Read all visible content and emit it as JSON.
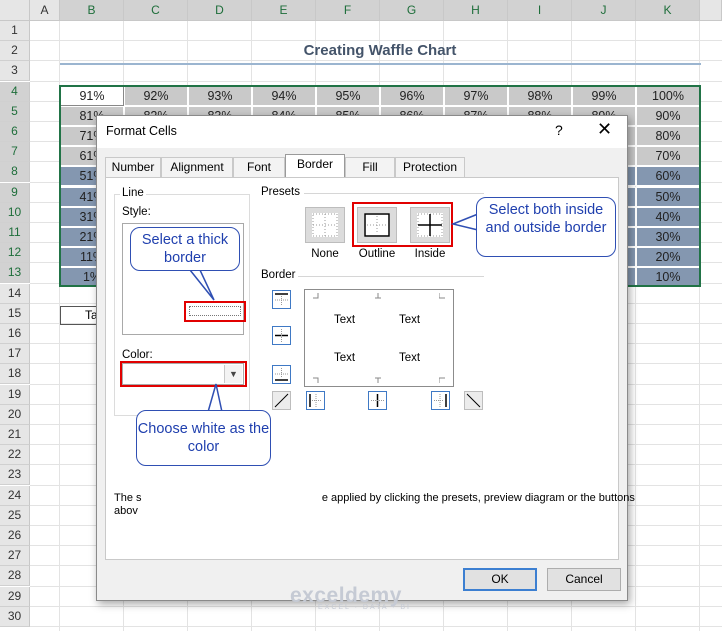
{
  "sheet": {
    "columns": [
      "A",
      "B",
      "C",
      "D",
      "E",
      "F",
      "G",
      "H",
      "I",
      "J",
      "K"
    ],
    "rows": [
      "1",
      "2",
      "3",
      "4",
      "5",
      "6",
      "7",
      "8",
      "9",
      "10",
      "11",
      "12",
      "13",
      "14",
      "15",
      "16",
      "17",
      "18",
      "19",
      "20",
      "21",
      "22",
      "23",
      "24",
      "25",
      "26",
      "27",
      "28",
      "29",
      "30"
    ],
    "title": "Creating Waffle Chart",
    "grid": [
      [
        "91%",
        "92%",
        "93%",
        "94%",
        "95%",
        "96%",
        "97%",
        "98%",
        "99%",
        "100%"
      ],
      [
        "81%",
        "82%",
        "83%",
        "84%",
        "85%",
        "86%",
        "87%",
        "88%",
        "89%",
        "90%"
      ],
      [
        "71%",
        "",
        "",
        "",
        "",
        "",
        "",
        "",
        "",
        "80%"
      ],
      [
        "61%",
        "",
        "",
        "",
        "",
        "",
        "",
        "",
        "",
        "70%"
      ],
      [
        "51%",
        "",
        "",
        "",
        "",
        "",
        "",
        "",
        "",
        "60%"
      ],
      [
        "41%",
        "",
        "",
        "",
        "",
        "",
        "",
        "",
        "",
        "50%"
      ],
      [
        "31%",
        "",
        "",
        "",
        "",
        "",
        "",
        "",
        "",
        "40%"
      ],
      [
        "21%",
        "",
        "",
        "",
        "",
        "",
        "",
        "",
        "",
        "30%"
      ],
      [
        "11%",
        "",
        "",
        "",
        "",
        "",
        "",
        "",
        "",
        "20%"
      ],
      [
        "1%",
        "",
        "",
        "",
        "",
        "",
        "",
        "",
        "",
        "10%"
      ]
    ],
    "legend_cell": "Ta",
    "colors": {
      "filled": "#8497b0",
      "empty": "#c9c9c9",
      "selection": "#217346"
    }
  },
  "dialog": {
    "title": "Format Cells",
    "help": "?",
    "close": "✕",
    "tabs": [
      "Number",
      "Alignment",
      "Font",
      "Border",
      "Fill",
      "Protection"
    ],
    "active_tab": "Border",
    "line_group": "Line",
    "style_label": "Style:",
    "color_label": "Color:",
    "presets_label": "Presets",
    "presets": [
      "None",
      "Outline",
      "Inside"
    ],
    "border_label": "Border",
    "preview_text": [
      "Text",
      "Text",
      "Text",
      "Text"
    ],
    "hint_line1": "The s                                                           e applied by clicking the presets, preview diagram or the buttons",
    "hint_line2": "abov",
    "ok": "OK",
    "cancel": "Cancel"
  },
  "callouts": {
    "thick_border": "Select a thick border",
    "white_color": "Choose white as the color",
    "both_borders": "Select both inside and outside border"
  },
  "watermark": {
    "name": "exceldemy",
    "tagline": "EXCEL · DATA · BI"
  }
}
